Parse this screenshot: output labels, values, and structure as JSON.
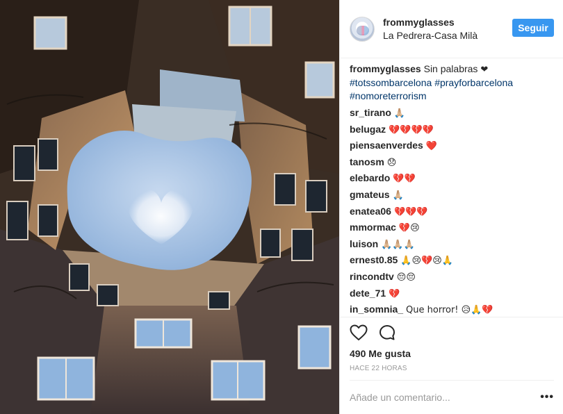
{
  "header": {
    "username": "frommyglasses",
    "location": "La Pedrera-Casa Milà",
    "follow_label": "Seguir"
  },
  "caption": {
    "username": "frommyglasses",
    "text": "Sin palabras",
    "emoji": "❤",
    "hashtags": [
      "#totssombarcelona",
      "#prayforbarcelona",
      "#nomoreterrorism"
    ]
  },
  "comments": [
    {
      "user": "sr_tirano",
      "text": "🙏🏼"
    },
    {
      "user": "belugaz",
      "text": "💔💔💔💔"
    },
    {
      "user": "piensaenverdes",
      "text": "❤️"
    },
    {
      "user": "tanosm",
      "text": "😞"
    },
    {
      "user": "elebardo",
      "text": "💔💔"
    },
    {
      "user": "gmateus",
      "text": "🙏🏼"
    },
    {
      "user": "enatea06",
      "text": "💔💔💔"
    },
    {
      "user": "mmormac",
      "text": "💔😢"
    },
    {
      "user": "luison",
      "text": "🙏🏼🙏🏼🙏🏼"
    },
    {
      "user": "ernest0.85",
      "text": "🙏😢💔😢🙏"
    },
    {
      "user": "rincondtv",
      "text": "😔😔"
    },
    {
      "user": "dete_71",
      "text": "💔"
    },
    {
      "user": "in_somnia_",
      "text": "Que horror! 😥🙏💔"
    }
  ],
  "icons": {
    "like": "heart-outline-icon",
    "comment": "speech-bubble-icon",
    "more": "more-options-icon"
  },
  "stats": {
    "likes": "490 Me gusta",
    "time": "HACE 22 HORAS"
  },
  "comment_box": {
    "placeholder": "Añade un comentario...",
    "more_label": "•••"
  },
  "colors": {
    "accent": "#3897f0",
    "hashtag": "#003569",
    "muted": "#999999"
  }
}
